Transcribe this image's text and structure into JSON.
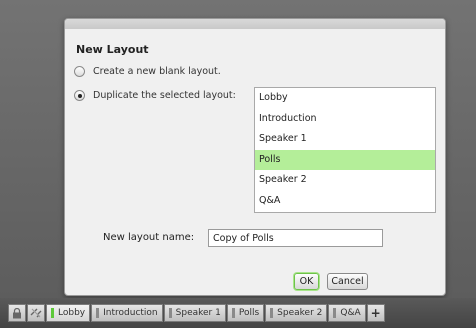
{
  "dialog": {
    "title": "New Layout",
    "option_blank": "Create a new blank layout.",
    "option_duplicate": "Duplicate the selected layout:",
    "selected_option": "duplicate",
    "layouts": [
      "Lobby",
      "Introduction",
      "Speaker 1",
      "Polls",
      "Speaker 2",
      "Q&A"
    ],
    "selected_layout": "Polls",
    "name_label": "New layout name:",
    "name_value": "Copy of Polls",
    "ok_label": "OK",
    "cancel_label": "Cancel"
  },
  "taskbar": {
    "tabs": [
      "Lobby",
      "Introduction",
      "Speaker 1",
      "Polls",
      "Speaker 2",
      "Q&A"
    ],
    "active_tab": "Lobby",
    "icons": [
      "lock-icon",
      "unlink-icon",
      "add-icon"
    ],
    "add_label": "+"
  },
  "colors": {
    "selection": "#b4ee99",
    "active_indicator": "#5ec93a"
  }
}
